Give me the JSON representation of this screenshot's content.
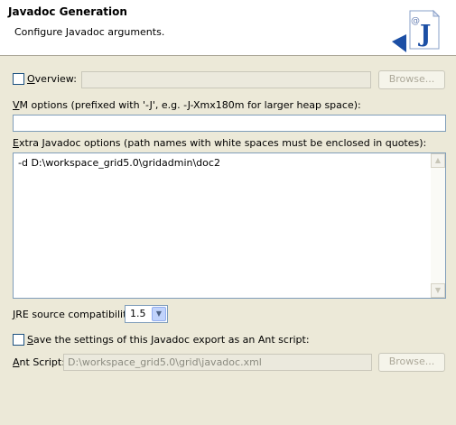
{
  "header": {
    "title": "Javadoc Generation",
    "subtitle": "Configure Javadoc arguments."
  },
  "overview": {
    "label_mnemonic": "O",
    "label_rest": "verview:",
    "value": "",
    "checked": false,
    "browse_label": "Browse..."
  },
  "vm_options": {
    "label_mnemonic": "V",
    "label_rest": "M options (prefixed with '-J', e.g. -J-Xmx180m for larger heap space):",
    "value": ""
  },
  "extra_options": {
    "label_mnemonic": "E",
    "label_rest": "xtra Javadoc options (path names with white spaces must be enclosed in quotes):",
    "value": "-d D:\\workspace_grid5.0\\gridadmin\\doc2"
  },
  "jre": {
    "label_mnemonic": "J",
    "label_rest": "RE source compatibility:",
    "value": "1.5"
  },
  "save_ant": {
    "label_mnemonic": "S",
    "label_rest": "ave the settings of this Javadoc export as an Ant script:",
    "checked": false
  },
  "ant_script": {
    "label_mnemonic": "A",
    "label_rest": "nt Script:",
    "value": "D:\\workspace_grid5.0\\grid\\javadoc.xml",
    "browse_label": "Browse..."
  },
  "icons": {
    "logo": "javadoc-wizard-icon",
    "dropdown": "chevron-down-icon",
    "scroll_up": "scroll-up-arrow-icon",
    "scroll_down": "scroll-down-arrow-icon"
  },
  "colors": {
    "dialog_background": "#ece9d8",
    "header_background": "#ffffff",
    "field_border": "#7f9db9",
    "disabled_text": "#8b8b80",
    "logo_accent": "#1c4fa5"
  }
}
